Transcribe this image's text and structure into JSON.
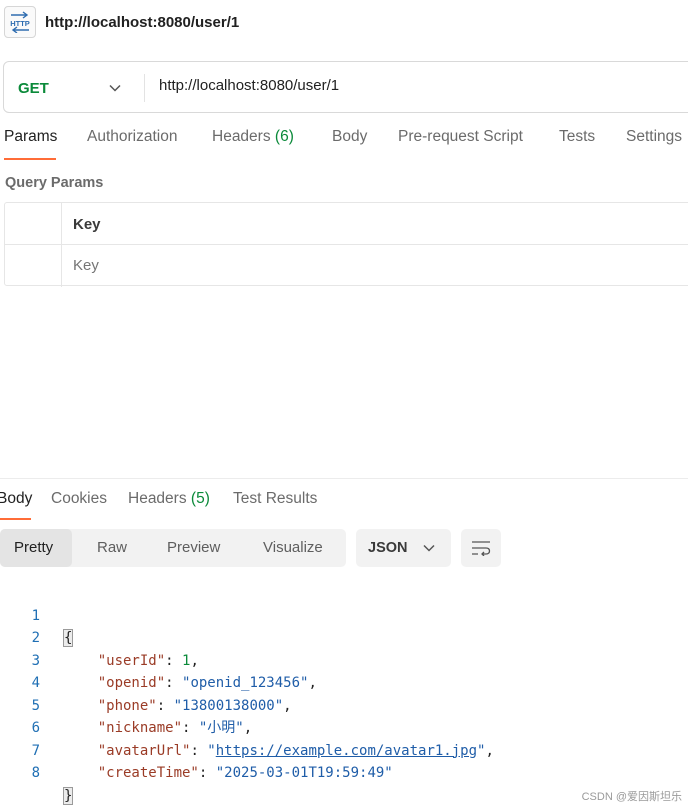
{
  "title": "http://localhost:8080/user/1",
  "http_icon_label": "HTTP",
  "request": {
    "method": "GET",
    "url": "http://localhost:8080/user/1"
  },
  "request_tabs": [
    {
      "label": "Params",
      "count": null
    },
    {
      "label": "Authorization",
      "count": null
    },
    {
      "label": "Headers",
      "count": "(6)"
    },
    {
      "label": "Body",
      "count": null
    },
    {
      "label": "Pre-request Script",
      "count": null
    },
    {
      "label": "Tests",
      "count": null
    },
    {
      "label": "Settings",
      "count": null
    }
  ],
  "query_params": {
    "title": "Query Params",
    "column_key": "Key",
    "key_placeholder": "Key"
  },
  "response_tabs": [
    {
      "label": "Body",
      "count": null
    },
    {
      "label": "Cookies",
      "count": null
    },
    {
      "label": "Headers",
      "count": "(5)"
    },
    {
      "label": "Test Results",
      "count": null
    }
  ],
  "view_modes": [
    "Pretty",
    "Raw",
    "Preview",
    "Visualize"
  ],
  "format": "JSON",
  "code_lines": [
    {
      "num": "1",
      "text": "{"
    },
    {
      "num": "2",
      "key": "\"userId\"",
      "value": "1",
      "vtype": "number"
    },
    {
      "num": "3",
      "key": "\"openid\"",
      "value": "\"openid_123456\"",
      "vtype": "string"
    },
    {
      "num": "4",
      "key": "\"phone\"",
      "value": "\"13800138000\"",
      "vtype": "string"
    },
    {
      "num": "5",
      "key": "\"nickname\"",
      "value": "\"小明\"",
      "vtype": "string"
    },
    {
      "num": "6",
      "key": "\"avatarUrl\"",
      "value_pre": "\"",
      "link": "https://example.com/avatar1.jpg",
      "value_post": "\"",
      "vtype": "link"
    },
    {
      "num": "7",
      "key": "\"createTime\"",
      "value": "\"2025-03-01T19:59:49\"",
      "vtype": "string"
    },
    {
      "num": "8",
      "text": "}"
    }
  ],
  "watermark": "CSDN @爱因斯坦乐",
  "colors": {
    "accent": "#ff6c37",
    "method_get": "#0b8a3a",
    "json_key": "#9a3b26",
    "json_string": "#1f5da8",
    "json_number": "#0b8a3a"
  }
}
